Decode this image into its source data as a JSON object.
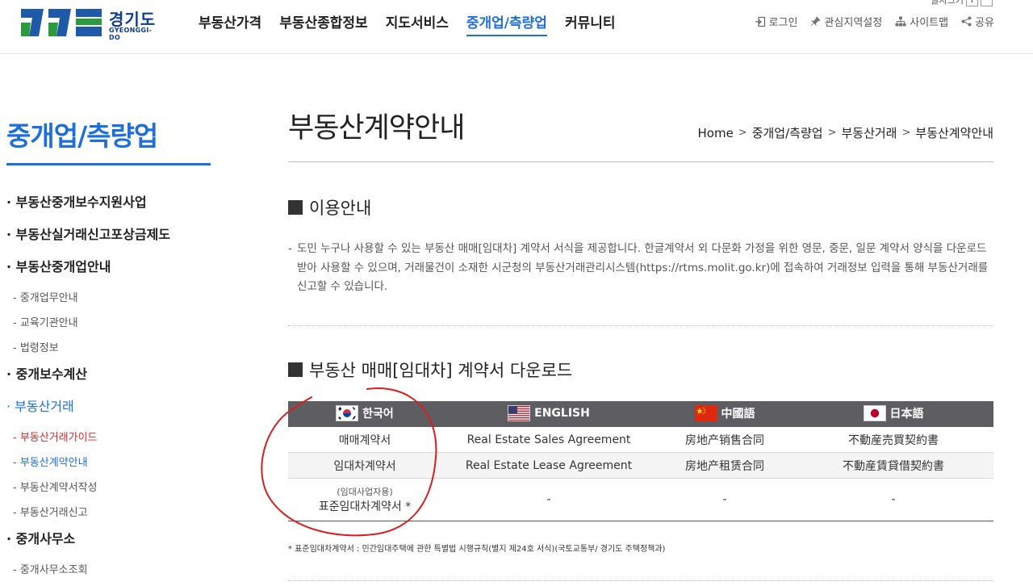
{
  "header": {
    "logo": {
      "text": "경기도",
      "sub": "GYEONGGI-DO"
    },
    "nav": [
      "부동산가격",
      "부동산종합정보",
      "지도서비스",
      "중개업/측량업",
      "커뮤니티"
    ],
    "active_nav_index": 3,
    "util": [
      {
        "label": "로그인",
        "icon": "login-icon"
      },
      {
        "label": "관심지역설정",
        "icon": "pin-icon"
      },
      {
        "label": "사이트맵",
        "icon": "sitemap-icon"
      },
      {
        "label": "공유",
        "icon": "share-icon"
      }
    ],
    "font_size": {
      "label": "글자크기",
      "plus": "+",
      "minus": "−"
    }
  },
  "sidebar": {
    "title": "중개업/측량업",
    "items": [
      {
        "label": "부동산중개보수지원사업",
        "depth": 1
      },
      {
        "label": "부동산실거래신고포상금제도",
        "depth": 1
      },
      {
        "label": "부동산중개업안내",
        "depth": 1
      },
      {
        "label": "중개업무안내",
        "depth": 2
      },
      {
        "label": "교육기관안내",
        "depth": 2
      },
      {
        "label": "법령정보",
        "depth": 2
      },
      {
        "label": "중개보수계산",
        "depth": 1
      },
      {
        "label": "부동산거래",
        "depth": 1,
        "active": true
      },
      {
        "label": "부동산거래가이드",
        "depth": 2,
        "state": "red"
      },
      {
        "label": "부동산계약안내",
        "depth": 2,
        "state": "current"
      },
      {
        "label": "부동산계약서작성",
        "depth": 2
      },
      {
        "label": "부동산거래신고",
        "depth": 2
      },
      {
        "label": "중개사무소",
        "depth": 1
      },
      {
        "label": "중개사무소조회",
        "depth": 2
      }
    ]
  },
  "page": {
    "title": "부동산계약안내",
    "breadcrumb": [
      "Home",
      "중개업/측량업",
      "부동산거래",
      "부동산계약안내"
    ],
    "section1_title": "이용안내",
    "section1_desc": "도민 누구나 사용할 수 있는 부동산 매매[임대차] 계약서 서식을 제공합니다. 한글계약서 외 다문화 가정을 위한 영문, 중문, 일문 계약서 양식을 다운로드 받아 사용할 수 있으며, 거래물건이 소재한 시군청의 부동산거래관리시스템(https://rtms.molit.go.kr)에 접속하여 거래정보 입력을 통해 부동산거래를 신고할 수 있습니다.",
    "section2_title": "부동산 매매[임대차] 계약서 다운로드",
    "table": {
      "headers": [
        {
          "label": "한국어",
          "flag": "korea-flag-icon"
        },
        {
          "label": "ENGLISH",
          "flag": "usa-flag-icon"
        },
        {
          "label": "中國語",
          "flag": "china-flag-icon"
        },
        {
          "label": "日本語",
          "flag": "japan-flag-icon"
        }
      ],
      "rows": [
        [
          "매매계약서",
          "Real Estate Sales Agreement",
          "房地产销售合同",
          "不動産売買契約書"
        ],
        [
          "임대차계약서",
          "Real Estate Lease Agreement",
          "房地产租赁合同",
          "不動産賃貸借契約書"
        ]
      ],
      "last_row": {
        "small": "(임대사업자용)",
        "main": "표준임대차계약서 *",
        "others": [
          "-",
          "-",
          "-"
        ]
      }
    },
    "note": "* 표준임대차계약서 : 민간임대주택에 관한 특별법 시행규칙(별지 제24호 서식)(국토교통부/ 경기도 주택정책과)"
  },
  "colors": {
    "accent": "#1e6fd9",
    "logo": "#0f3c8c",
    "table_header": "#5e5e62",
    "annotation": "#d61f1f"
  }
}
